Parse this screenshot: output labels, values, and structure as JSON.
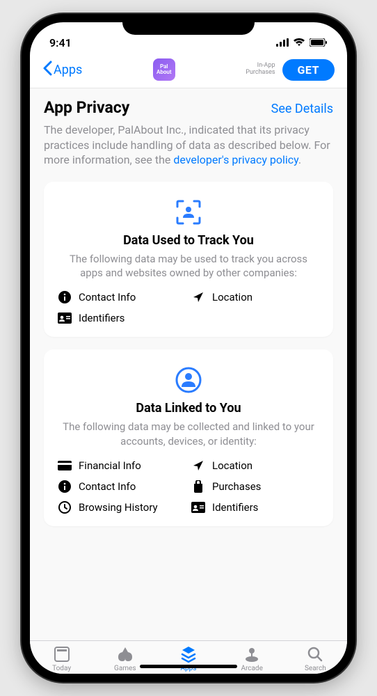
{
  "status": {
    "time": "9:41"
  },
  "nav": {
    "back_label": "Apps",
    "app_icon_text": "Pal\nAbout",
    "iap_line1": "In-App",
    "iap_line2": "Purchases",
    "get_label": "GET"
  },
  "header": {
    "title": "App Privacy",
    "see_details": "See Details"
  },
  "intro": {
    "prefix": "The developer, ",
    "developer": "PalAbout Inc.,",
    "middle": " indicated that its privacy practices include handling of data as described below. For more information, see the ",
    "link": "developer's privacy policy",
    "suffix": "."
  },
  "card_track": {
    "title": "Data Used to Track You",
    "desc": "The following data may be used to track you across apps and websites owned by other companies:",
    "items": [
      {
        "icon": "info",
        "label": "Contact Info"
      },
      {
        "icon": "location",
        "label": "Location"
      },
      {
        "icon": "id",
        "label": "Identifiers"
      }
    ]
  },
  "card_linked": {
    "title": "Data Linked to You",
    "desc": "The following data may be collected and linked to your accounts, devices, or identity:",
    "items": [
      {
        "icon": "card",
        "label": "Financial Info"
      },
      {
        "icon": "location",
        "label": "Location"
      },
      {
        "icon": "info",
        "label": "Contact Info"
      },
      {
        "icon": "bag",
        "label": "Purchases"
      },
      {
        "icon": "clock",
        "label": "Browsing History"
      },
      {
        "icon": "id",
        "label": "Identifiers"
      }
    ]
  },
  "tabs": {
    "today": "Today",
    "games": "Games",
    "apps": "Apps",
    "arcade": "Arcade",
    "search": "Search"
  }
}
